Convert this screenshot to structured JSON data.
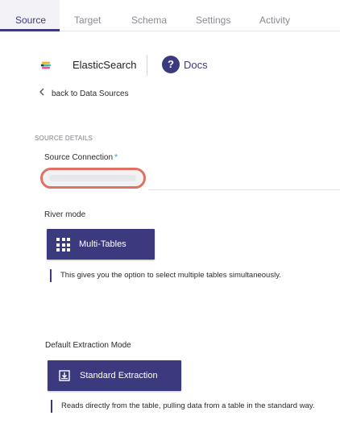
{
  "tabs": [
    {
      "label": "Source",
      "active": true
    },
    {
      "label": "Target",
      "active": false
    },
    {
      "label": "Schema",
      "active": false
    },
    {
      "label": "Settings",
      "active": false
    },
    {
      "label": "Activity",
      "active": false
    }
  ],
  "header": {
    "logo_icon": "elasticsearch-logo-icon",
    "title": "ElasticSearch",
    "docs_icon": "question-mark-icon",
    "docs_icon_glyph": "?",
    "docs_label": "Docs"
  },
  "back_link": {
    "icon": "chevron-left-icon",
    "label": "back to Data Sources"
  },
  "source_details": {
    "section_label": "SOURCE DETAILS",
    "connection_label": "Source Connection",
    "required_marker": "*",
    "connection_value": ""
  },
  "river_mode": {
    "label": "River mode",
    "button_icon": "grid-icon",
    "button_label": "Multi-Tables",
    "description": "This gives you the option to select multiple tables simultaneously."
  },
  "extraction": {
    "label": "Default Extraction Mode",
    "button_icon": "download-tray-icon",
    "button_label": "Standard Extraction",
    "description": "Reads directly from the table, pulling data from a table in the standard way."
  },
  "colors": {
    "primary": "#3b3a7e",
    "highlight_outline": "#e0705f",
    "required": "#24a6c7"
  }
}
